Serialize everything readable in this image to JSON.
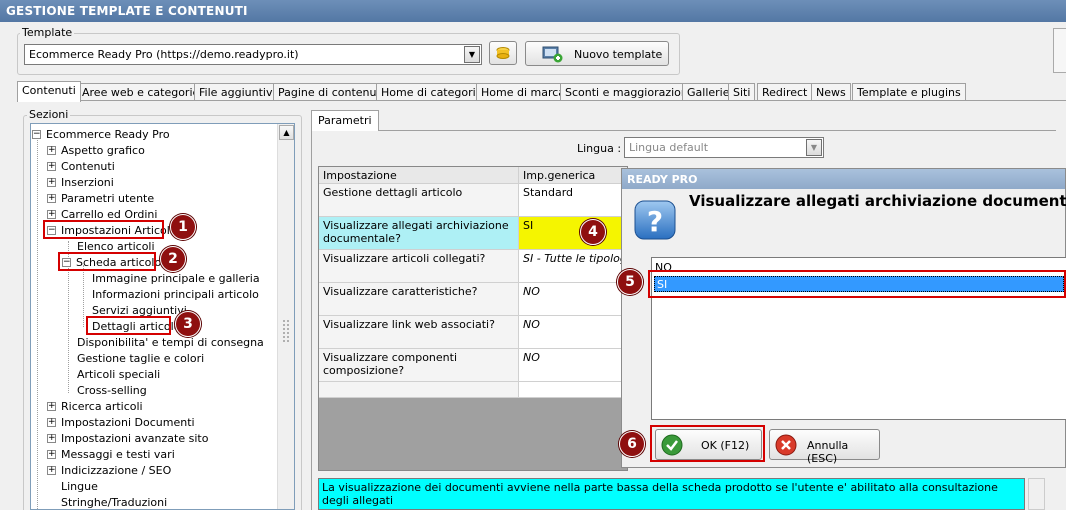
{
  "window": {
    "title": "GESTIONE TEMPLATE E CONTENUTI"
  },
  "template": {
    "group_label": "Template",
    "selected": "Ecommerce Ready Pro (https://demo.readypro.it)",
    "new_button_label": "Nuovo template"
  },
  "tabs": [
    "Contenuti",
    "Aree web e categorie",
    "File aggiuntivi",
    "Pagine di contenuti",
    "Home di categoria",
    "Home di marca",
    "Sconti e maggiorazioni",
    "Gallerie",
    "Siti",
    "Redirect",
    "News",
    "Template e plugins"
  ],
  "sections": {
    "group_label": "Sezioni",
    "tree": [
      {
        "label": "Ecommerce Ready Pro",
        "level": 0,
        "expander": "−"
      },
      {
        "label": "Aspetto grafico",
        "level": 1,
        "expander": "+"
      },
      {
        "label": "Contenuti",
        "level": 1,
        "expander": "+"
      },
      {
        "label": "Inserzioni",
        "level": 1,
        "expander": "+"
      },
      {
        "label": "Parametri utente",
        "level": 1,
        "expander": "+"
      },
      {
        "label": "Carrello ed Ordini",
        "level": 1,
        "expander": "+"
      },
      {
        "label": "Impostazioni Articoli",
        "level": 1,
        "expander": "−"
      },
      {
        "label": "Elenco articoli",
        "level": 2,
        "expander": ""
      },
      {
        "label": "Scheda articolo",
        "level": 2,
        "expander": "−"
      },
      {
        "label": "Immagine principale e galleria",
        "level": 3,
        "expander": ""
      },
      {
        "label": "Informazioni principali articolo",
        "level": 3,
        "expander": ""
      },
      {
        "label": "Servizi aggiuntivi",
        "level": 3,
        "expander": ""
      },
      {
        "label": "Dettagli articolo",
        "level": 3,
        "expander": ""
      },
      {
        "label": "Disponibilita' e tempi di consegna",
        "level": 2,
        "expander": ""
      },
      {
        "label": "Gestione taglie e colori",
        "level": 2,
        "expander": ""
      },
      {
        "label": "Articoli speciali",
        "level": 2,
        "expander": ""
      },
      {
        "label": "Cross-selling",
        "level": 2,
        "expander": ""
      },
      {
        "label": "Ricerca articoli",
        "level": 1,
        "expander": "+"
      },
      {
        "label": "Impostazioni Documenti",
        "level": 1,
        "expander": "+"
      },
      {
        "label": "Impostazioni avanzate sito",
        "level": 1,
        "expander": "+"
      },
      {
        "label": "Messaggi e testi vari",
        "level": 1,
        "expander": "+"
      },
      {
        "label": "Indicizzazione / SEO",
        "level": 1,
        "expander": "+"
      },
      {
        "label": "Lingue",
        "level": 1,
        "expander": ""
      },
      {
        "label": "Stringhe/Traduzioni",
        "level": 1,
        "expander": ""
      }
    ]
  },
  "params": {
    "tab_label": "Parametri",
    "language_label": "Lingua :",
    "language_value": "Lingua default",
    "col_setting": "Impostazione",
    "col_value": "Imp.generica",
    "rows": [
      {
        "setting": "Gestione dettagli articolo",
        "value": "Standard"
      },
      {
        "setting": "Visualizzare allegati archiviazione documentale?",
        "value": "SI"
      },
      {
        "setting": "Visualizzare articoli collegati?",
        "value": "SI - Tutte le tipologie"
      },
      {
        "setting": "Visualizzare caratteristiche?",
        "value": "NO"
      },
      {
        "setting": "Visualizzare link web associati?",
        "value": "NO"
      },
      {
        "setting": "Visualizzare componenti composizione?",
        "value": "NO"
      }
    ],
    "description": "La visualizzazione dei documenti avviene nella parte bassa della scheda prodotto se l'utente e' abilitato alla consultazione degli allegati"
  },
  "dialog": {
    "title": "READY PRO",
    "question": "Visualizzare allegati archiviazione documentale?",
    "options": [
      "NO",
      "SI"
    ],
    "selected_option": "SI",
    "ok_label": "OK (F12)",
    "cancel_label": "Annulla (ESC)"
  },
  "markers": [
    "1",
    "2",
    "3",
    "4",
    "5",
    "6"
  ],
  "colors": {
    "highlight_yellow": "#f5f500",
    "selected_row_cyan": "#aef0f5",
    "annotation_red": "#d40000",
    "list_selection_blue": "#3399ff"
  }
}
